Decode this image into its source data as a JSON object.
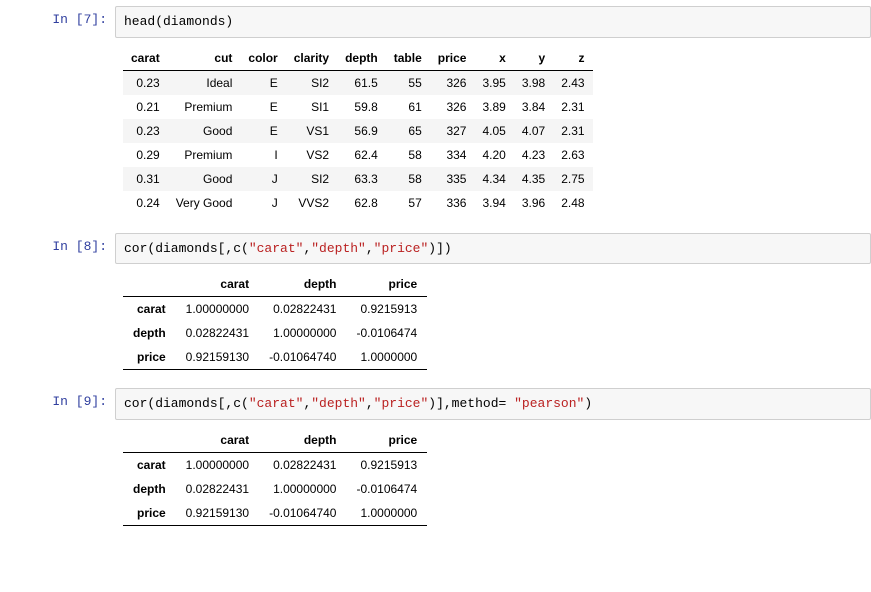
{
  "cells": {
    "c7": {
      "prompt_prefix": "In  [",
      "prompt_num": "7",
      "prompt_suffix": "]:",
      "code_plain": "head(diamonds)"
    },
    "c8": {
      "prompt_prefix": "In  [",
      "prompt_num": "8",
      "prompt_suffix": "]:",
      "code_pre1": "cor(diamonds[,c(",
      "code_str1": "\"carat\"",
      "code_sep1": ",",
      "code_str2": "\"depth\"",
      "code_sep2": ",",
      "code_str3": "\"price\"",
      "code_post1": ")])"
    },
    "c9": {
      "prompt_prefix": "In  [",
      "prompt_num": "9",
      "prompt_suffix": "]:",
      "code_pre1": "cor(diamonds[,c(",
      "code_str1": "\"carat\"",
      "code_sep1": ",",
      "code_str2": "\"depth\"",
      "code_sep2": ",",
      "code_str3": "\"price\"",
      "code_mid": ")],method= ",
      "code_str4": "\"pearson\"",
      "code_post1": ")"
    }
  },
  "diamonds": {
    "headers": [
      "carat",
      "cut",
      "color",
      "clarity",
      "depth",
      "table",
      "price",
      "x",
      "y",
      "z"
    ],
    "rows": [
      [
        "0.23",
        "Ideal",
        "E",
        "SI2",
        "61.5",
        "55",
        "326",
        "3.95",
        "3.98",
        "2.43"
      ],
      [
        "0.21",
        "Premium",
        "E",
        "SI1",
        "59.8",
        "61",
        "326",
        "3.89",
        "3.84",
        "2.31"
      ],
      [
        "0.23",
        "Good",
        "E",
        "VS1",
        "56.9",
        "65",
        "327",
        "4.05",
        "4.07",
        "2.31"
      ],
      [
        "0.29",
        "Premium",
        "I",
        "VS2",
        "62.4",
        "58",
        "334",
        "4.20",
        "4.23",
        "2.63"
      ],
      [
        "0.31",
        "Good",
        "J",
        "SI2",
        "63.3",
        "58",
        "335",
        "4.34",
        "4.35",
        "2.75"
      ],
      [
        "0.24",
        "Very Good",
        "J",
        "VVS2",
        "62.8",
        "57",
        "336",
        "3.94",
        "3.96",
        "2.48"
      ]
    ]
  },
  "cor": {
    "headers": [
      "",
      "carat",
      "depth",
      "price"
    ],
    "rows": [
      {
        "name": "carat",
        "values": [
          "1.00000000",
          "0.02822431",
          "0.9215913"
        ]
      },
      {
        "name": "depth",
        "values": [
          "0.02822431",
          "1.00000000",
          "-0.0106474"
        ]
      },
      {
        "name": "price",
        "values": [
          "0.92159130",
          "-0.01064740",
          "1.0000000"
        ]
      }
    ]
  }
}
